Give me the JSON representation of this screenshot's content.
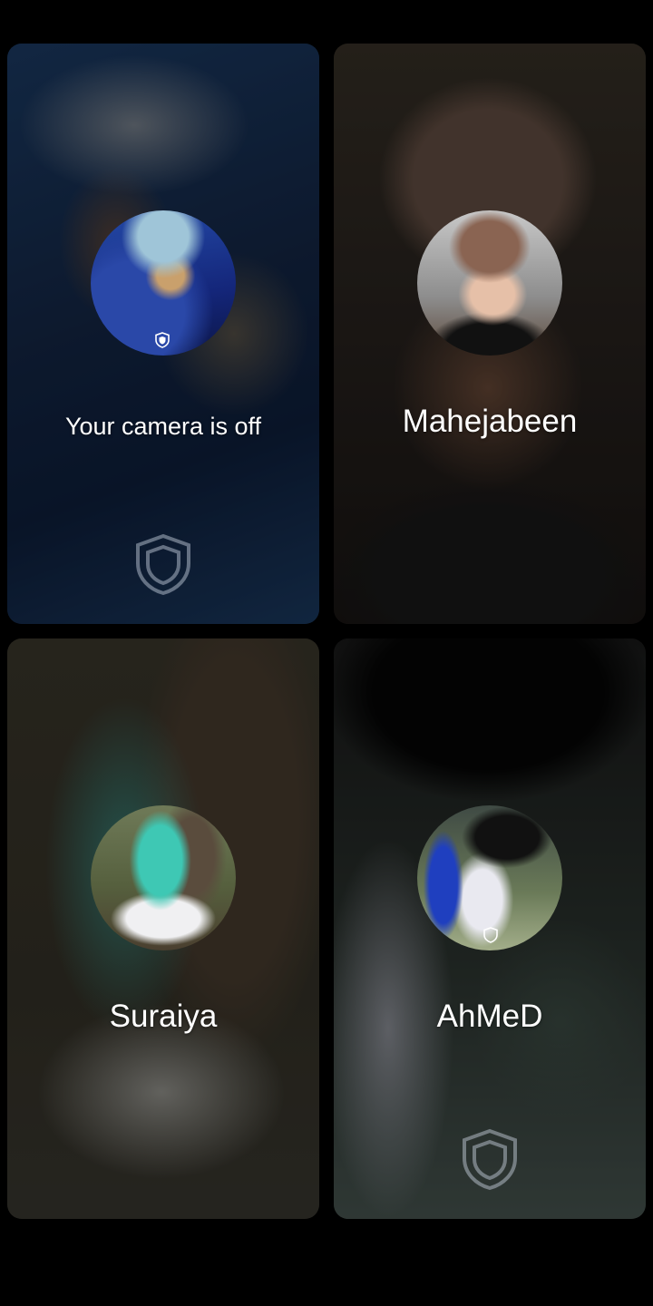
{
  "participants": [
    {
      "name": "Your camera is off",
      "is_self": true
    },
    {
      "name": "Mahejabeen",
      "is_self": false
    },
    {
      "name": "Suraiya",
      "is_self": false
    },
    {
      "name": "AhMeD",
      "is_self": false
    }
  ],
  "icons": {
    "shield": "shield-icon"
  },
  "colors": {
    "background": "#000000",
    "text": "#ffffff"
  }
}
